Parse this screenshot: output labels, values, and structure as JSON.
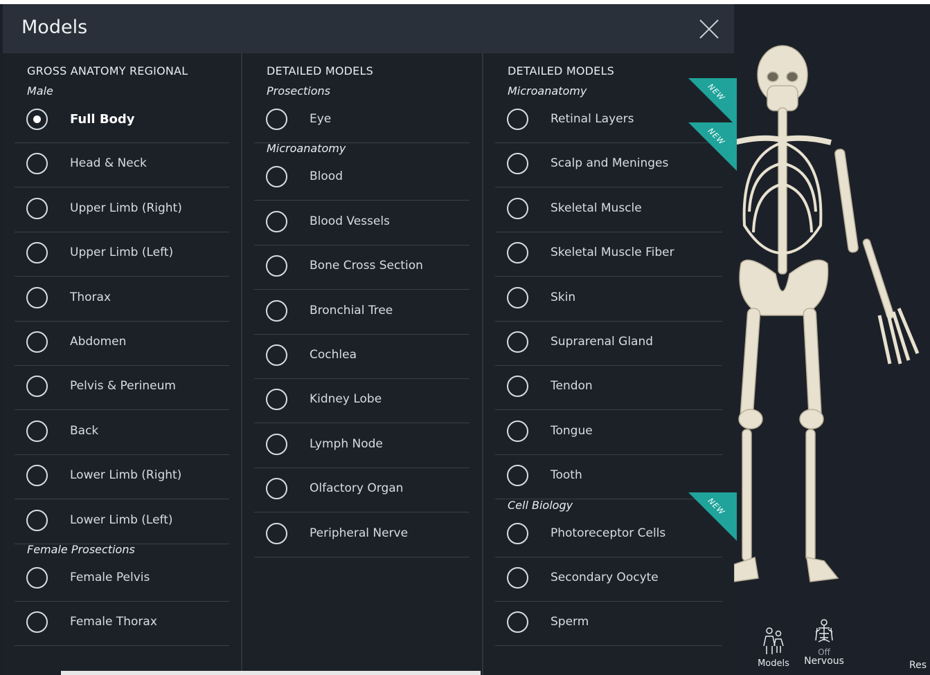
{
  "header": {
    "title": "Models",
    "close_icon": "close-icon"
  },
  "columns": [
    {
      "heading": "GROSS ANATOMY REGIONAL",
      "sections": [
        {
          "title": "Male",
          "items": [
            {
              "label": "Full Body",
              "selected": true
            },
            {
              "label": "Head & Neck"
            },
            {
              "label": "Upper Limb (Right)"
            },
            {
              "label": "Upper Limb (Left)"
            },
            {
              "label": "Thorax"
            },
            {
              "label": "Abdomen"
            },
            {
              "label": "Pelvis & Perineum"
            },
            {
              "label": "Back"
            },
            {
              "label": "Lower Limb (Right)"
            },
            {
              "label": "Lower Limb (Left)"
            }
          ]
        },
        {
          "title": "Female Prosections",
          "items": [
            {
              "label": "Female Pelvis"
            },
            {
              "label": "Female Thorax"
            }
          ]
        }
      ]
    },
    {
      "heading": "DETAILED MODELS",
      "sections": [
        {
          "title": "Prosections",
          "items": [
            {
              "label": "Eye"
            }
          ]
        },
        {
          "title": "Microanatomy",
          "items": [
            {
              "label": "Blood"
            },
            {
              "label": "Blood Vessels"
            },
            {
              "label": "Bone Cross Section"
            },
            {
              "label": "Bronchial Tree"
            },
            {
              "label": "Cochlea"
            },
            {
              "label": "Kidney Lobe"
            },
            {
              "label": "Lymph Node"
            },
            {
              "label": "Olfactory Organ"
            },
            {
              "label": "Peripheral Nerve"
            }
          ]
        }
      ]
    },
    {
      "heading": "DETAILED MODELS",
      "sections": [
        {
          "title": "Microanatomy",
          "items": [
            {
              "label": "Retinal Layers",
              "new": true
            },
            {
              "label": "Scalp and Meninges",
              "new": true
            },
            {
              "label": "Skeletal Muscle"
            },
            {
              "label": "Skeletal Muscle Fiber"
            },
            {
              "label": "Skin"
            },
            {
              "label": "Suprarenal Gland"
            },
            {
              "label": "Tendon"
            },
            {
              "label": "Tongue"
            },
            {
              "label": "Tooth"
            }
          ]
        },
        {
          "title": "Cell Biology",
          "items": [
            {
              "label": "Photoreceptor Cells",
              "new": true
            },
            {
              "label": "Secondary Oocyte"
            },
            {
              "label": "Sperm"
            }
          ]
        }
      ]
    }
  ],
  "badge_text": "NEW",
  "toolbar": {
    "models_label": "Models",
    "nervous_label": "Nervous",
    "nervous_state": "Off",
    "reset_label": "Res"
  },
  "colors": {
    "accent": "#1fa39a",
    "panel": "#1c2128",
    "header": "#2a3039"
  }
}
